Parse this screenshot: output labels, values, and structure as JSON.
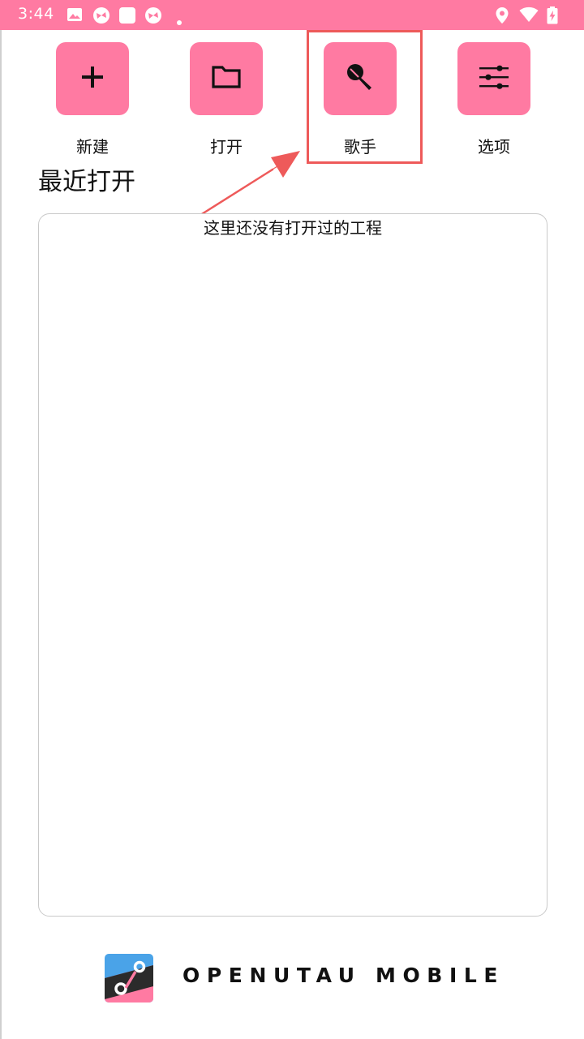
{
  "status_bar": {
    "time": "3:44",
    "left_icons": [
      "image-icon",
      "app-icon",
      "square-app-icon",
      "app-icon",
      "dot-icon"
    ],
    "right_icons": [
      "location-icon",
      "wifi-icon",
      "battery-charging-icon"
    ]
  },
  "actions": [
    {
      "id": "new",
      "label": "新建",
      "icon": "plus-icon"
    },
    {
      "id": "open",
      "label": "打开",
      "icon": "folder-icon"
    },
    {
      "id": "singers",
      "label": "歌手",
      "icon": "microphone-icon"
    },
    {
      "id": "options",
      "label": "选项",
      "icon": "sliders-icon"
    }
  ],
  "recent": {
    "title": "最近打开",
    "empty_message": "这里还没有打开过的工程"
  },
  "footer": {
    "brand": "OPENUTAU MOBILE"
  },
  "colors": {
    "accent": "#ff7aa2",
    "annotation": "#ee5a5a",
    "panel_border": "#c9c9c9"
  }
}
